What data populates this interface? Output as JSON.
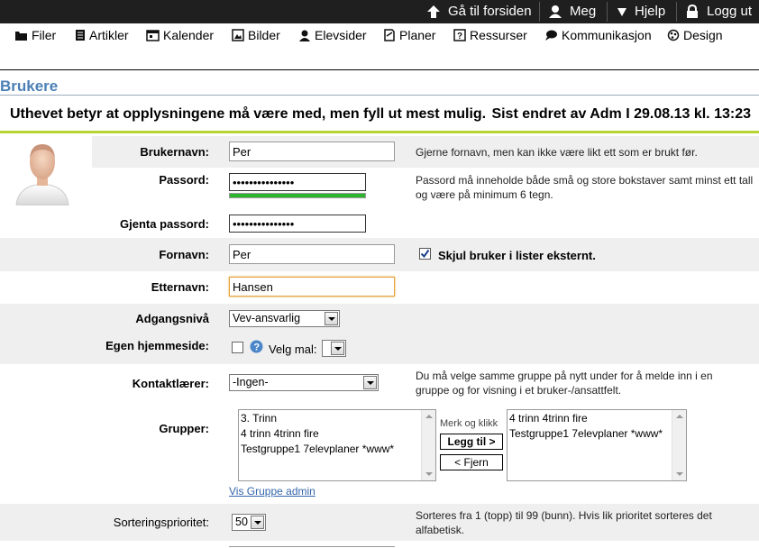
{
  "topbar": {
    "home": "Gå til forsiden",
    "me": "Meg",
    "help": "Hjelp",
    "logout": "Logg ut"
  },
  "menu": [
    {
      "label": "Filer",
      "icon": "folder-icon"
    },
    {
      "label": "Artikler",
      "icon": "articles-icon"
    },
    {
      "label": "Kalender",
      "icon": "calendar-icon"
    },
    {
      "label": "Bilder",
      "icon": "image-icon"
    },
    {
      "label": "Elevsider",
      "icon": "student-icon"
    },
    {
      "label": "Planer",
      "icon": "plan-icon"
    },
    {
      "label": "Ressurser",
      "icon": "resource-icon"
    },
    {
      "label": "Kommunikasjon",
      "icon": "chat-icon"
    },
    {
      "label": "Design",
      "icon": "design-icon"
    }
  ],
  "page_title": "Brukere",
  "info": {
    "left": "Uthevet betyr at opplysningene må være med, men fyll ut mest mulig.",
    "right": "Sist endret av Adm I 29.08.13 kl. 13:23"
  },
  "form": {
    "username_label": "Brukernavn:",
    "username_value": "Per",
    "username_hint": "Gjerne fornavn, men kan ikke være likt ett som er brukt før.",
    "password_label": "Passord:",
    "password_value": "•••••••••••••••",
    "password_hint": "Passord må inneholde både små og store bokstaver samt minst ett tall og være på minimum 6 tegn.",
    "password_strength": 1.0,
    "repeat_label": "Gjenta passord:",
    "repeat_value": "•••••••••••••••",
    "firstname_label": "Fornavn:",
    "firstname_value": "Per",
    "hide_user_label": "Skjul bruker i lister eksternt.",
    "hide_user_checked": true,
    "lastname_label": "Etternavn:",
    "lastname_value": "Hansen",
    "access_label": "Adgangsnivå",
    "access_value": "Vev-ansvarlig",
    "homepage_label": "Egen hjemmeside:",
    "homepage_checked": false,
    "template_label": "Velg mal:",
    "template_value": "",
    "contact_label": "Kontaktlærer:",
    "contact_value": "-Ingen-",
    "contact_hint": "Du må velge samme gruppe på nytt under for å melde inn i en gruppe og for visning i et bruker-/ansattfelt.",
    "groups_label": "Grupper:",
    "groups_available": [
      "3. Trinn",
      "4 trinn 4trinn fire",
      "Testgruppe1 7elevplaner *www*"
    ],
    "mark_click": "Merk og klikk",
    "add_button": "Legg til >",
    "remove_button": "< Fjern",
    "groups_selected": [
      "4 trinn 4trinn fire",
      "Testgruppe1 7elevplaner *www*"
    ],
    "group_admin_link": "Vis Gruppe admin",
    "sort_label": "Sorteringsprioritet:",
    "sort_value": "50",
    "sort_hint": "Sorteres fra 1 (topp) til 99 (bunn). Hvis lik prioritet sorteres det alfabetisk."
  },
  "colors": {
    "topbar_bg": "#1f1f1f",
    "title_blue": "#4b7fb6",
    "accent_green": "#b6d233",
    "strength_green": "#2db52d",
    "row_gray": "#efefef"
  }
}
